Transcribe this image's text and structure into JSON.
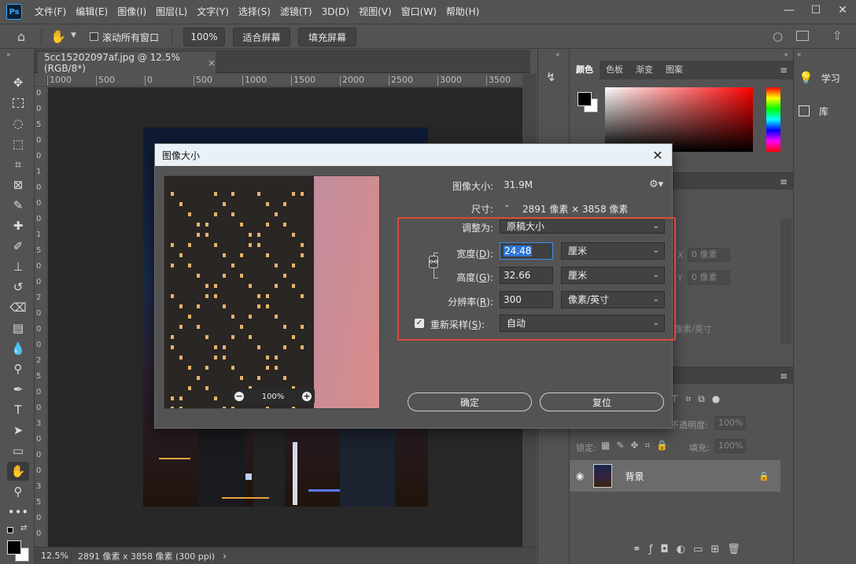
{
  "menubar": {
    "logo": "Ps",
    "items": [
      "文件(F)",
      "编辑(E)",
      "图像(I)",
      "图层(L)",
      "文字(Y)",
      "选择(S)",
      "滤镜(T)",
      "3D(D)",
      "视图(V)",
      "窗口(W)",
      "帮助(H)"
    ]
  },
  "options": {
    "scroll_all_windows": "滚动所有窗口",
    "zoom_100": "100%",
    "fit_screen": "适合屏幕",
    "fill_screen": "填充屏幕"
  },
  "document": {
    "tab_title": "5cc15202097af.jpg @ 12.5%(RGB/8*)",
    "tab_close": "×",
    "ruler_h": [
      "1000",
      "500",
      "0",
      "500",
      "1000",
      "1500",
      "2000",
      "2500",
      "3000",
      "3500"
    ],
    "ruler_v": [
      "0",
      "0",
      "5",
      "0",
      "0",
      "1",
      "0",
      "0",
      "0",
      "1",
      "5",
      "0",
      "0",
      "2",
      "0",
      "0",
      "0",
      "2",
      "5",
      "0",
      "0",
      "3",
      "0",
      "0",
      "0",
      "3",
      "5",
      "0",
      "0"
    ]
  },
  "status": {
    "zoom": "12.5%",
    "doc_info": "2891 像素 x 3858 像素 (300 ppi)",
    "arrow": "›"
  },
  "panels": {
    "color_tabs": [
      "颜色",
      "色板",
      "渐变",
      "图案"
    ],
    "ghost_x_label": "X",
    "ghost_y_label": "Y",
    "ghost_x_value": "0 像素",
    "ghost_y_value": "0 像素",
    "ghost_res": "像素/英寸",
    "opacity_label": "不透明度:",
    "opacity_value": "100%",
    "lock_label": "锁定:",
    "fill_label": "填充:",
    "fill_value": "100%",
    "layer_name": "背景",
    "learn": "学习",
    "library": "库"
  },
  "dialog": {
    "title": "图像大小",
    "close": "✕",
    "image_size_label": "图像大小:",
    "image_size_value": "31.9M",
    "dimensions_label": "尺寸:",
    "dimensions_value": "2891 像素  ×  3858 像素",
    "fit_to_label": "调整为:",
    "fit_to_value": "原稿大小",
    "width_label": "宽度(",
    "width_key": "D",
    "width_value": "24.48",
    "width_unit": "厘米",
    "height_label": "高度(",
    "height_key": "G",
    "height_value": "32.66",
    "height_unit": "厘米",
    "resolution_label": "分辨率(",
    "resolution_key": "R",
    "resolution_value": "300",
    "resolution_unit": "像素/英寸",
    "resample_label": "重新采样(",
    "resample_key": "S",
    "resample_value": "自动",
    "resample_checked": true,
    "preview_zoom": "100%",
    "ok": "确定",
    "reset": "复位",
    "highlight_color": "#e0463c"
  }
}
